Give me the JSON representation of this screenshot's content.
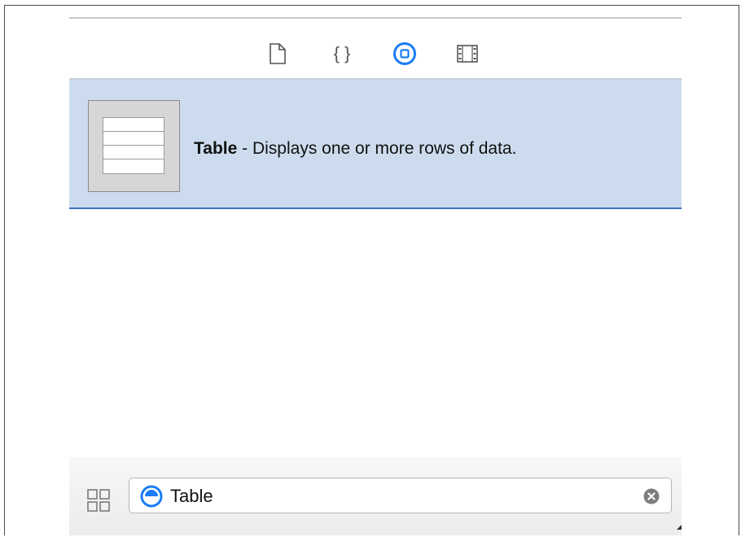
{
  "inspector_tabs": [
    {
      "name": "file-inspector",
      "icon": "document-icon",
      "selected": false
    },
    {
      "name": "code-snippet",
      "icon": "braces-icon",
      "selected": false
    },
    {
      "name": "object-library",
      "icon": "object-library-icon",
      "selected": true
    },
    {
      "name": "media-library",
      "icon": "film-strip-icon",
      "selected": false
    }
  ],
  "library_item": {
    "title": "Table",
    "separator": " - ",
    "description": "Displays one or more rows of data.",
    "icon": "table-thumbnail-icon"
  },
  "filter_bar": {
    "search_value": "Table",
    "view_mode_icon": "grid-view-icon",
    "filter_icon": "object-filter-icon",
    "clear_icon": "clear-icon"
  },
  "colors": {
    "accent": "#1a7cf5",
    "selection_bg": "#ccdcee",
    "selection_border": "#3a6fc4"
  }
}
